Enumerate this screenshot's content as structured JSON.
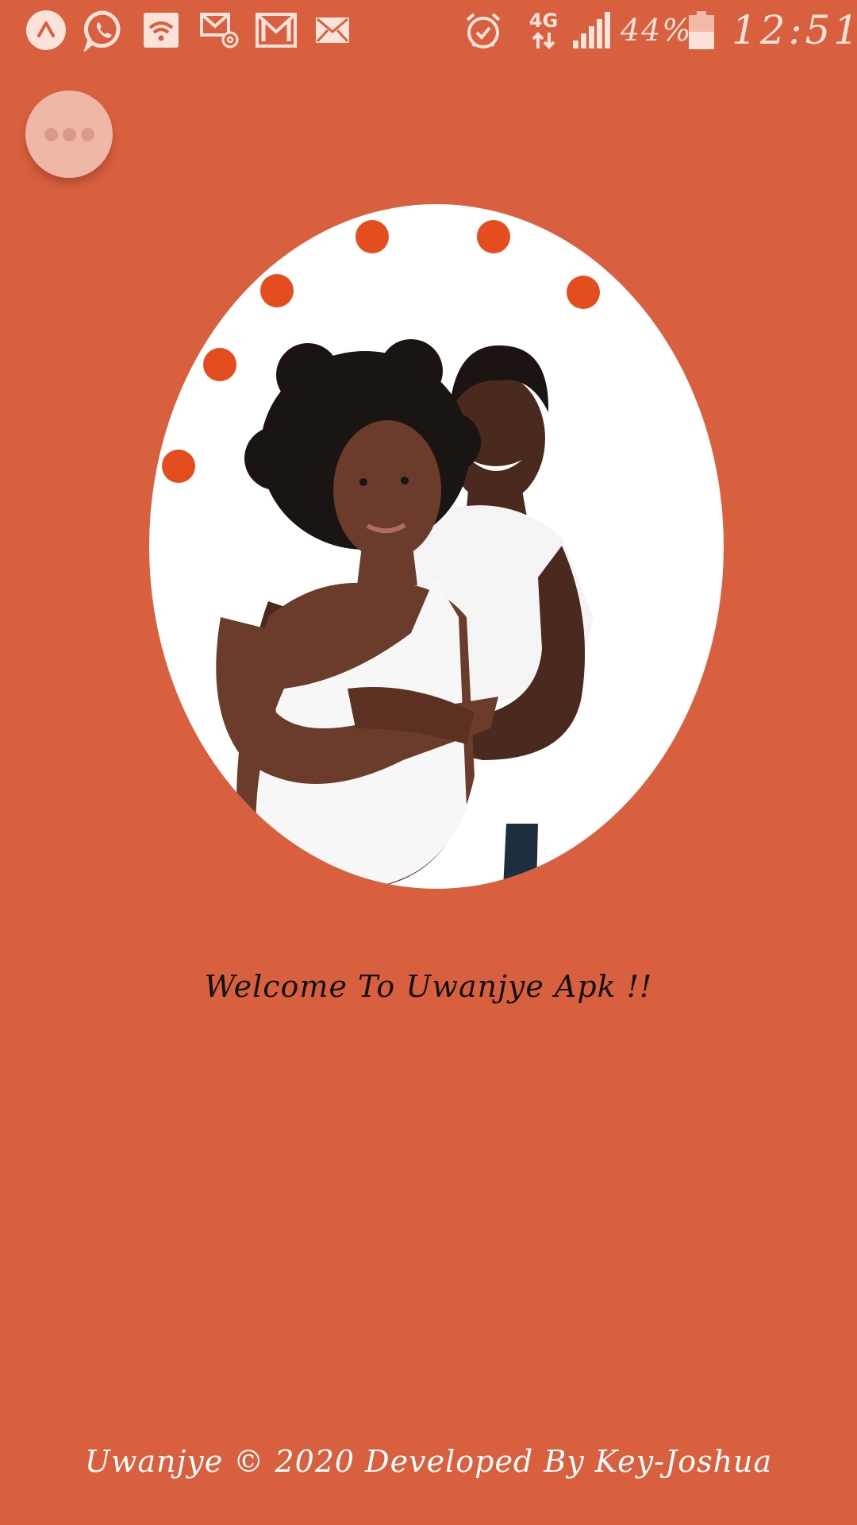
{
  "status_bar": {
    "icons": [
      "app-launcher-icon",
      "whatsapp-icon",
      "wifi-icon",
      "email-at-icon",
      "gmail-icon",
      "mail-icon",
      "alarm-icon",
      "mobile-data-4g-icon",
      "signal-icon",
      "battery-icon"
    ],
    "network_type": "4G",
    "battery_percent": "44%",
    "time": "12:51"
  },
  "menu_button": {
    "icon": "more-horizontal-icon"
  },
  "hero": {
    "image": "couple-embrace-photo"
  },
  "welcome_text": "Welcome To Uwanjye Apk !!",
  "footer_text": "Uwanjye © 2020 Developed By Key-Joshua",
  "colors": {
    "background": "#D8603F",
    "loader_dot": "#E44E1F",
    "menu_button": "#EFB7A7",
    "welcome_text": "#111111",
    "footer_text": "#FFFFFF"
  }
}
